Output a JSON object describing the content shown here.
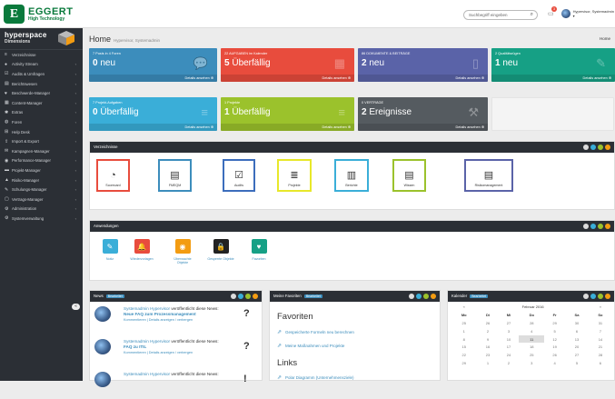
{
  "topbar": {
    "logo_mark": "E",
    "logo_name": "EGGERT",
    "logo_sub": "High Technology",
    "search_placeholder": "Suchbegriff eingeben",
    "notif_count": "3",
    "user_name": "Hypervisor, Systemadmin ▾"
  },
  "sidebar": {
    "brand_line1": "hyperspace",
    "brand_line2": "Dimensions",
    "items": [
      {
        "icon": "list-icon",
        "glyph": "≡",
        "label": "Verzeichnisse",
        "arrow": ""
      },
      {
        "icon": "activity-icon",
        "glyph": "●",
        "label": "Activity Stream",
        "arrow": "‹"
      },
      {
        "icon": "check-icon",
        "glyph": "☑",
        "label": "Audits & Umfragen",
        "arrow": "‹"
      },
      {
        "icon": "report-icon",
        "glyph": "▤",
        "label": "Berichtswesen",
        "arrow": "‹"
      },
      {
        "icon": "heart-icon",
        "glyph": "♥",
        "label": "Beschwerde-Manager",
        "arrow": "‹"
      },
      {
        "icon": "content-icon",
        "glyph": "▦",
        "label": "Content-Manager",
        "arrow": "‹"
      },
      {
        "icon": "star-icon",
        "glyph": "✱",
        "label": "Extras",
        "arrow": "‹"
      },
      {
        "icon": "forum-icon",
        "glyph": "◍",
        "label": "Foren",
        "arrow": "‹"
      },
      {
        "icon": "helpdesk-icon",
        "glyph": "⊞",
        "label": "Help Desk",
        "arrow": "‹"
      },
      {
        "icon": "import-icon",
        "glyph": "⇪",
        "label": "Import & Export",
        "arrow": "‹"
      },
      {
        "icon": "campaign-icon",
        "glyph": "✉",
        "label": "Kampagnen-Manager",
        "arrow": "‹"
      },
      {
        "icon": "performance-icon",
        "glyph": "◉",
        "label": "Performance-Manager",
        "arrow": "‹"
      },
      {
        "icon": "project-icon",
        "glyph": "▬",
        "label": "Projekt-Manager",
        "arrow": "‹"
      },
      {
        "icon": "risk-icon",
        "glyph": "▲",
        "label": "Risiko-Manager",
        "arrow": "‹"
      },
      {
        "icon": "training-icon",
        "glyph": "✎",
        "label": "Schulungs-Manager",
        "arrow": "‹"
      },
      {
        "icon": "contract-icon",
        "glyph": "▢",
        "label": "Vertrags-Manager",
        "arrow": "‹"
      },
      {
        "icon": "admin-icon",
        "glyph": "⚙",
        "label": "Administration",
        "arrow": "‹"
      },
      {
        "icon": "sysadmin-icon",
        "glyph": "⚙",
        "label": "Systemverwaltung",
        "arrow": "‹"
      }
    ],
    "collapse_glyph": "«"
  },
  "page": {
    "title": "Home",
    "subtitle": "Hypervisor, Systemadmin",
    "breadcrumb": "Home"
  },
  "tiles": [
    {
      "label": "7 Posts in 4 Foren",
      "num": "0",
      "text": " neu",
      "footer": "Details ansehen ⊕",
      "color": "#3c8dbc",
      "glyph": "💬"
    },
    {
      "label": "22 AUFGABEN im Kalender",
      "num": "5",
      "text": " Überfällig",
      "footer": "Details ansehen ⊕",
      "color": "#e84c3d",
      "glyph": "▦"
    },
    {
      "label": "86 DOKUMENTE & BEITRÄGE",
      "num": "2",
      "text": " neu",
      "footer": "Details ansehen ⊕",
      "color": "#5a63a8",
      "glyph": "▯"
    },
    {
      "label": "2 Qualitätsrügen",
      "num": "1",
      "text": " neu",
      "footer": "Details ansehen ⊕",
      "color": "#16a085",
      "glyph": "✎"
    },
    {
      "label": "7 Projekt-Aufgaben",
      "num": "0",
      "text": " Überfällig",
      "footer": "Details ansehen ⊕",
      "color": "#3aaed8",
      "glyph": "≡"
    },
    {
      "label": "1 Projekte",
      "num": "1",
      "text": " Überfällig",
      "footer": "Details ansehen ⊕",
      "color": "#9bc22c",
      "glyph": "≡"
    },
    {
      "label": "0 VERTRÄGE",
      "num": "2",
      "text": " Ereignisse",
      "footer": "Details ansehen ⊕",
      "color": "#555b60",
      "glyph": "⚒"
    }
  ],
  "verzeichnisse": {
    "title": "Verzeichnisse",
    "items": [
      {
        "label": "Scorecard",
        "color": "#e84c3d",
        "glyph": "◔"
      },
      {
        "label": "FMEQM",
        "color": "#3c8dbc",
        "glyph": "▤"
      },
      {
        "label": "Audits",
        "color": "#3c6dbc",
        "glyph": "☑"
      },
      {
        "label": "Projekte",
        "color": "#e8e82a",
        "glyph": "≣"
      },
      {
        "label": "Berichte",
        "color": "#3aaed8",
        "glyph": "▥"
      },
      {
        "label": "Wissen",
        "color": "#9bc22c",
        "glyph": "▤"
      },
      {
        "label": "Risikomanagement",
        "color": "#5a63a8",
        "glyph": "▤"
      }
    ]
  },
  "anwendungen": {
    "title": "Anwendungen",
    "items": [
      {
        "label": "Notiz",
        "color": "#3aaed8",
        "glyph": "✎"
      },
      {
        "label": "Wiedervorlagen",
        "color": "#e84c3d",
        "glyph": "🔔"
      },
      {
        "label": "Überwachte Objekte",
        "color": "#f39c12",
        "glyph": "◉"
      },
      {
        "label": "Gesperrte Objekte",
        "color": "#222",
        "glyph": "🔒"
      },
      {
        "label": "Favoriten",
        "color": "#16a085",
        "glyph": "♥"
      }
    ]
  },
  "news": {
    "title": "News",
    "tag": "Bearbeitet",
    "items": [
      {
        "author": "Systemadmin Hypervisor",
        "action": " veröffentlicht diese News:",
        "headline": "Neue FAQ zum Prozessmanagement",
        "meta": "Kommentieren | Details anzeigen / verbergen",
        "mark": "?"
      },
      {
        "author": "Systemadmin Hypervisor",
        "action": " veröffentlicht diese News:",
        "headline": "FAQ zu ITIL",
        "meta": "Kommentieren | Details anzeigen / verbergen",
        "mark": "?"
      },
      {
        "author": "Systemadmin Hypervisor",
        "action": " veröffentlicht diese News:",
        "headline": "",
        "meta": "",
        "mark": "!"
      }
    ]
  },
  "favoriten": {
    "title": "Meine Favoriten",
    "tag": "Bearbeitet",
    "heading": "Favoriten",
    "items": [
      "Gespeicherte Formeln neu berechnen",
      "Meine Maßnahmen und Projekte"
    ],
    "links_heading": "Links",
    "links": [
      "Polar Diagramm (Unternehmensziele)"
    ]
  },
  "kalender": {
    "title": "Kalender",
    "tag": "Bearbeitet",
    "month": "Februar 2016",
    "prev": "«",
    "next": "»",
    "days": [
      "Mo",
      "Di",
      "Mi",
      "Do",
      "Fr",
      "Sa",
      "So"
    ],
    "weeks": [
      [
        "25",
        "26",
        "27",
        "28",
        "29",
        "30",
        "31"
      ],
      [
        "1",
        "2",
        "3",
        "4",
        "5",
        "6",
        "7"
      ],
      [
        "8",
        "9",
        "10",
        "11",
        "12",
        "13",
        "14"
      ],
      [
        "15",
        "16",
        "17",
        "18",
        "19",
        "20",
        "21"
      ],
      [
        "22",
        "23",
        "24",
        "25",
        "26",
        "27",
        "28"
      ],
      [
        "29",
        "1",
        "2",
        "3",
        "4",
        "5",
        "6"
      ]
    ],
    "today": "11"
  },
  "colors": {
    "dot_grey": "#dcdcdc",
    "dot_blue": "#3aaed8",
    "dot_green": "#9bc22c",
    "dot_orange": "#f39c12",
    "dot_red": "#e84c3d"
  }
}
